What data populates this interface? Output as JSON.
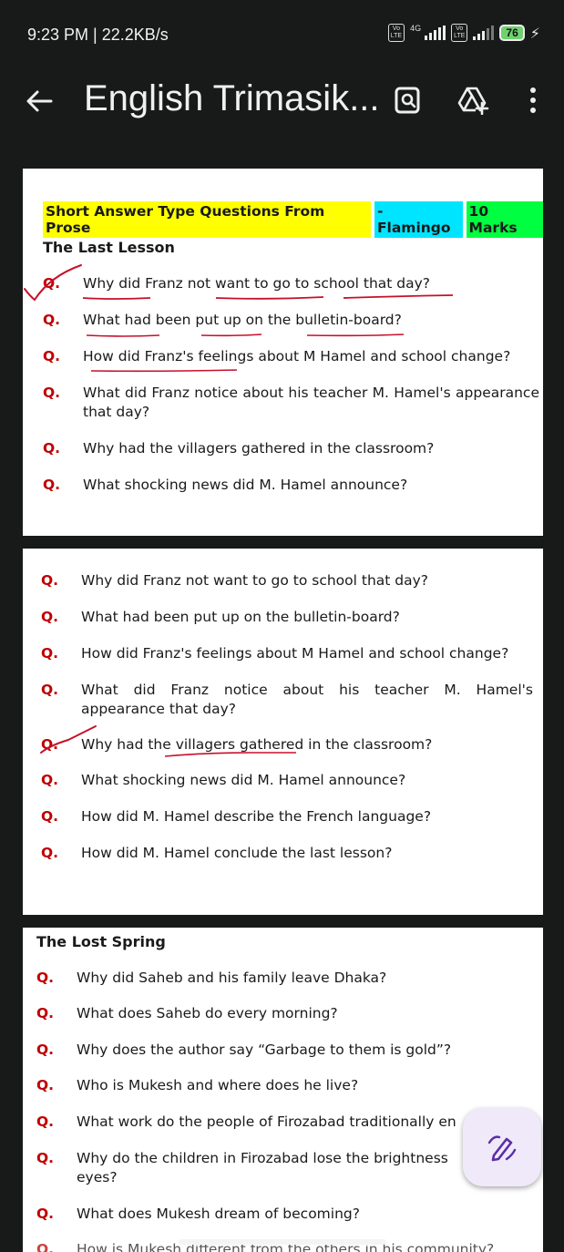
{
  "status_bar": {
    "time_speed": "9:23 PM | 22.2KB/s",
    "volte_label": "Vo LTE",
    "network": "4G",
    "battery": "76"
  },
  "app_bar": {
    "title": "English Trimasik...",
    "icons": [
      "back-arrow-icon",
      "lens-search-icon",
      "drive-add-icon",
      "more-vert-icon"
    ]
  },
  "page1": {
    "heading": {
      "part1": "Short Answer Type Questions From Prose",
      "part2": "- Flamingo",
      "part3": "10 Marks"
    },
    "chapter": "The Last Lesson",
    "questions": [
      {
        "mark": "Q.",
        "text": "Why did Franz not want to go to school that day?"
      },
      {
        "mark": "Q.",
        "text": "What had been put up on the bulletin-board?"
      },
      {
        "mark": "Q.",
        "text": "How did Franz's feelings about M Hamel and school change?"
      },
      {
        "mark": "Q.",
        "text": "What did Franz notice about his teacher M. Hamel's appearance that day?"
      },
      {
        "mark": "Q.",
        "text": "Why had the villagers gathered in the classroom?"
      },
      {
        "mark": "Q.",
        "text": "What shocking news did M. Hamel announce?"
      }
    ]
  },
  "page2": {
    "questions": [
      {
        "mark": "Q.",
        "text": "Why did Franz not want to go to school that day?"
      },
      {
        "mark": "Q.",
        "text": "What had been put up on the bulletin-board?"
      },
      {
        "mark": "Q.",
        "text": "How did Franz's feelings about M Hamel and school change?"
      },
      {
        "mark": "Q.",
        "text": "What did Franz notice about his teacher M. Hamel's appearance that day?"
      },
      {
        "mark": "Q.",
        "text": "Why had the villagers gathered in the classroom?"
      },
      {
        "mark": "Q.",
        "text": "What shocking news did M. Hamel announce?"
      },
      {
        "mark": "Q.",
        "text": "How did M. Hamel describe the French language?"
      },
      {
        "mark": "Q.",
        "text": "How did M. Hamel conclude the last lesson?"
      }
    ]
  },
  "page3": {
    "chapter": "The Lost Spring",
    "questions": [
      {
        "mark": "Q.",
        "text": "Why did Saheb and his family leave Dhaka?"
      },
      {
        "mark": "Q.",
        "text": "What does Saheb do every morning?"
      },
      {
        "mark": "Q.",
        "text": "Why does the author say “Garbage to them is gold”?"
      },
      {
        "mark": "Q.",
        "text": "Who is Mukesh and where does he live?"
      },
      {
        "mark": "Q.",
        "text": "What work do the people of Firozabad traditionally en"
      },
      {
        "mark": "Q.",
        "text": "Why do the children in Firozabad lose the brightness eyes?"
      },
      {
        "mark": "Q.",
        "text": "What does Mukesh dream of becoming?"
      },
      {
        "mark": "Q.",
        "text": "How is Mukesh different from the others in his community?"
      }
    ]
  },
  "fab": {
    "icon": "annotate-pen-icon"
  },
  "colors": {
    "background": "#181a19",
    "page": "#ffffff",
    "question_mark": "#c00000",
    "highlight_yellow": "#ffff00",
    "highlight_cyan": "#00e5ff",
    "highlight_green": "#00ff40",
    "ink": "#c6102a",
    "fab_bg": "#efe9f9",
    "fab_icon": "#5b2ea6"
  }
}
